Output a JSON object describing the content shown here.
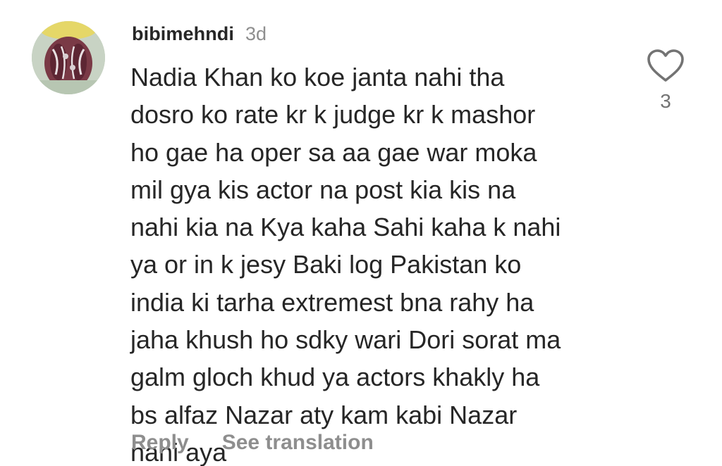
{
  "comment": {
    "username": "bibimehndi",
    "timestamp": "3d",
    "avatar_icon": "profile-photo",
    "text_lines": [
      "Nadia Khan ko koe janta nahi tha",
      "dosro ko rate kr k judge kr k mashor",
      "ho gae ha oper sa aa gae war moka",
      "mil gya kis actor na post kia kis na",
      "nahi kia na Kya kaha Sahi kaha k nahi",
      "ya or in k jesy Baki log Pakistan ko",
      "india ki tarha extremest bna rahy ha",
      "jaha khush ho sdky wari Dori sorat ma",
      "galm gloch khud ya actors khakly ha",
      "bs alfaz Nazar aty kam kabi Nazar",
      "nahi aya"
    ],
    "actions": {
      "reply_label": "Reply",
      "translate_label": "See translation"
    },
    "like": {
      "icon": "heart-outline-icon",
      "count": "3"
    }
  },
  "colors": {
    "text_primary": "#262626",
    "text_secondary": "#8e8e8e",
    "background": "#ffffff"
  }
}
